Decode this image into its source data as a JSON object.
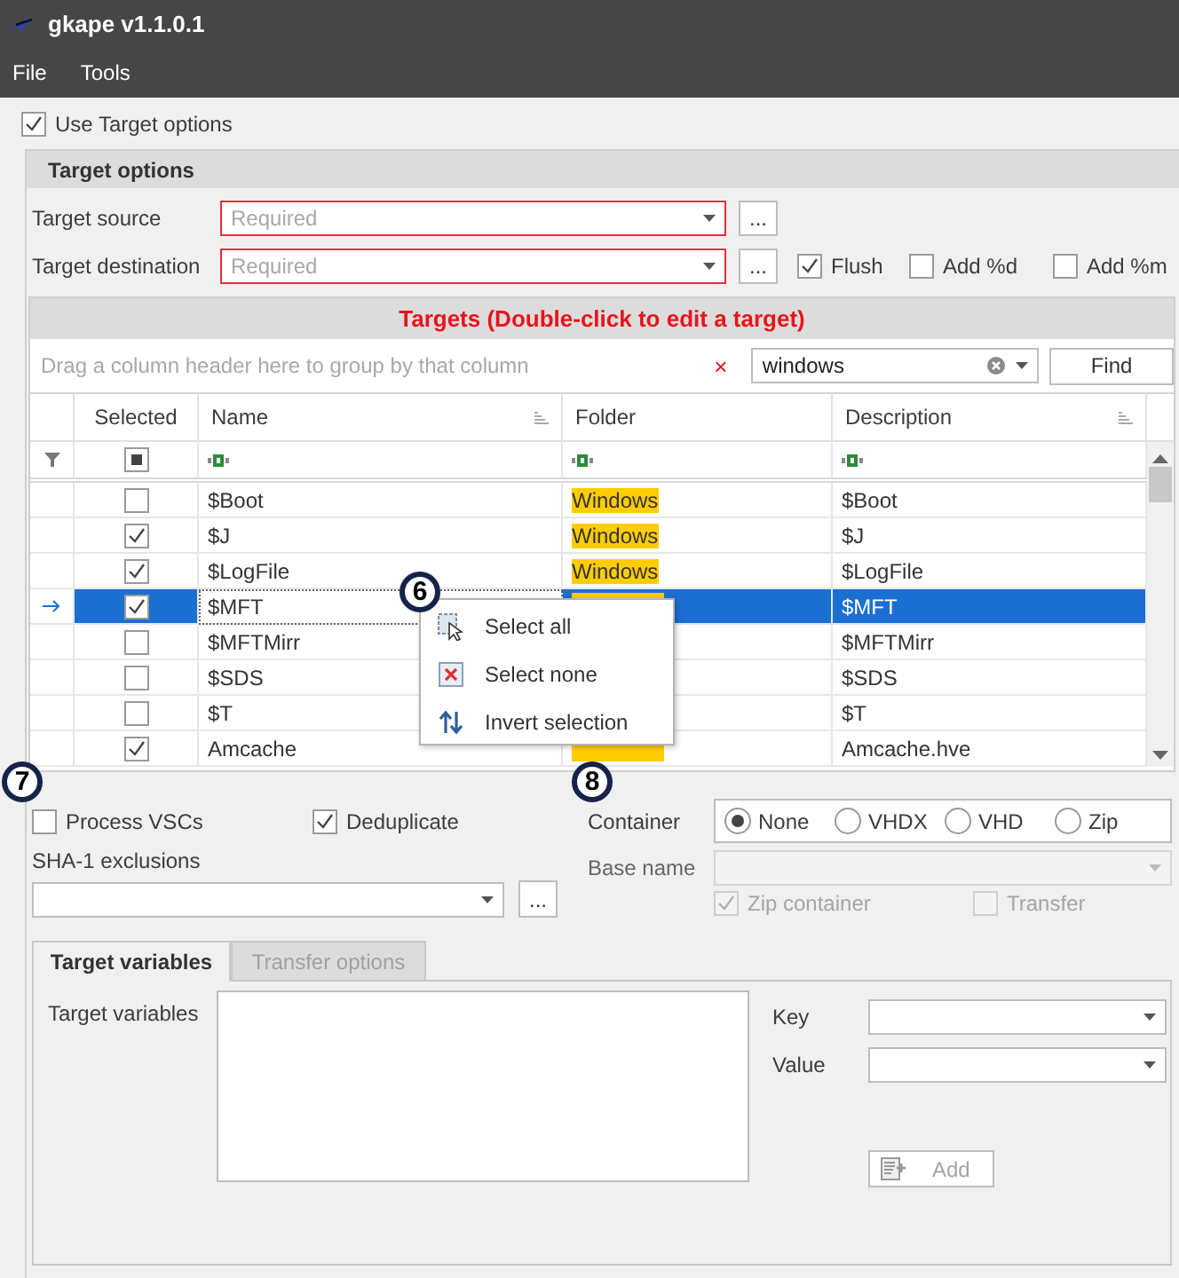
{
  "window": {
    "title": "gkape v1.1.0.1"
  },
  "menu": [
    "File",
    "Tools"
  ],
  "use_target_options": {
    "label": "Use Target options",
    "checked": true
  },
  "target_options": {
    "title": "Target options",
    "source": {
      "label": "Target source",
      "placeholder": "Required",
      "browse": "..."
    },
    "destination": {
      "label": "Target destination",
      "placeholder": "Required",
      "browse": "..."
    },
    "options": [
      {
        "label": "Flush",
        "checked": true
      },
      {
        "label": "Add %d",
        "checked": false
      },
      {
        "label": "Add %m",
        "checked": false
      }
    ]
  },
  "targets": {
    "title": "Targets (Double-click to edit a target)",
    "group_hint": "Drag a column header here to group by that column",
    "clear_search": "×",
    "search": "windows",
    "find": "Find",
    "columns": [
      "Selected",
      "Name",
      "Folder",
      "Description"
    ],
    "header_checkbox": {
      "indeterminate": true
    },
    "rows": [
      {
        "checked": false,
        "name": "$Boot",
        "folder": "Windows",
        "highlighted": true,
        "description": "$Boot",
        "selected": false
      },
      {
        "checked": true,
        "name": "$J",
        "folder": "Windows",
        "highlighted": true,
        "description": "$J",
        "selected": false
      },
      {
        "checked": true,
        "name": "$LogFile",
        "folder": "Windows",
        "highlighted": true,
        "description": "$LogFile",
        "selected": false
      },
      {
        "checked": true,
        "name": "$MFT",
        "highlighted": true,
        "description": "$MFT",
        "selected": true
      },
      {
        "checked": false,
        "name": "$MFTMirr",
        "description": "$MFTMirr",
        "selected": false
      },
      {
        "checked": false,
        "name": "$SDS",
        "description": "$SDS",
        "selected": false
      },
      {
        "checked": false,
        "name": "$T",
        "description": "$T",
        "selected": false
      },
      {
        "checked": true,
        "name": "Amcache",
        "highlighted": true,
        "description": "Amcache.hve",
        "selected": false
      }
    ]
  },
  "context_menu": [
    {
      "kind": "all",
      "label": "Select all"
    },
    {
      "kind": "none",
      "label": "Select none"
    },
    {
      "kind": "invert",
      "label": "Invert selection"
    }
  ],
  "process_vscs": {
    "label": "Process VSCs",
    "checked": false
  },
  "deduplicate": {
    "label": "Deduplicate",
    "checked": true
  },
  "sha1": {
    "label": "SHA-1 exclusions",
    "browse": "..."
  },
  "container": {
    "label": "Container",
    "options": [
      {
        "label": "None",
        "selected": true
      },
      {
        "label": "VHDX",
        "selected": false
      },
      {
        "label": "VHD",
        "selected": false
      },
      {
        "label": "Zip",
        "selected": false
      }
    ]
  },
  "base_name": {
    "label": "Base name",
    "disabled": true
  },
  "zip_container": {
    "label": "Zip container",
    "checked": true,
    "disabled": true
  },
  "transfer": {
    "label": "Transfer",
    "checked": false,
    "disabled": true
  },
  "tabs": [
    {
      "label": "Target variables",
      "selected": true
    },
    {
      "label": "Transfer options",
      "selected": false
    }
  ],
  "target_variables": {
    "label": "Target variables",
    "key": "Key",
    "value": "Value",
    "add": {
      "label": "Add",
      "disabled": true
    }
  },
  "callouts": [
    "6",
    "7",
    "8"
  ]
}
